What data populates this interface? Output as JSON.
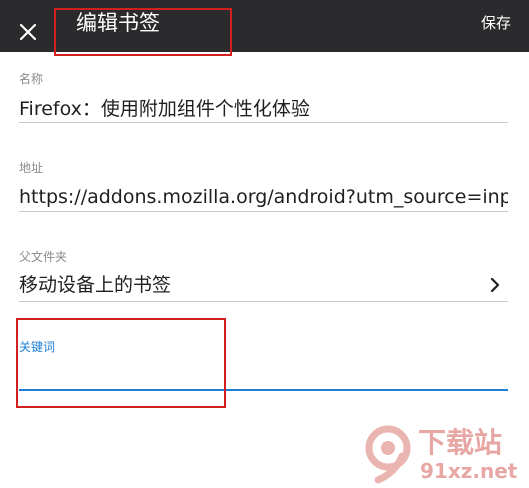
{
  "topbar": {
    "title": "编辑书签",
    "save_label": "保存",
    "close_icon": "close-icon",
    "background": "#2b2b2e"
  },
  "fields": {
    "name": {
      "label": "名称",
      "value": "Firefox：使用附加组件个性化体验"
    },
    "address": {
      "label": "地址",
      "value": "https://addons.mozilla.org/android?utm_source=inproduct"
    },
    "parent_folder": {
      "label": "父文件夹",
      "value": "移动设备上的书签",
      "chevron_icon": "chevron-right-icon"
    },
    "keyword": {
      "label": "关键词",
      "value": ""
    }
  },
  "colors": {
    "accent": "#1d7ed6",
    "annotation": "#d21f1f"
  },
  "watermark": {
    "text_top": "下载站",
    "text_bottom": "91xz.net"
  }
}
